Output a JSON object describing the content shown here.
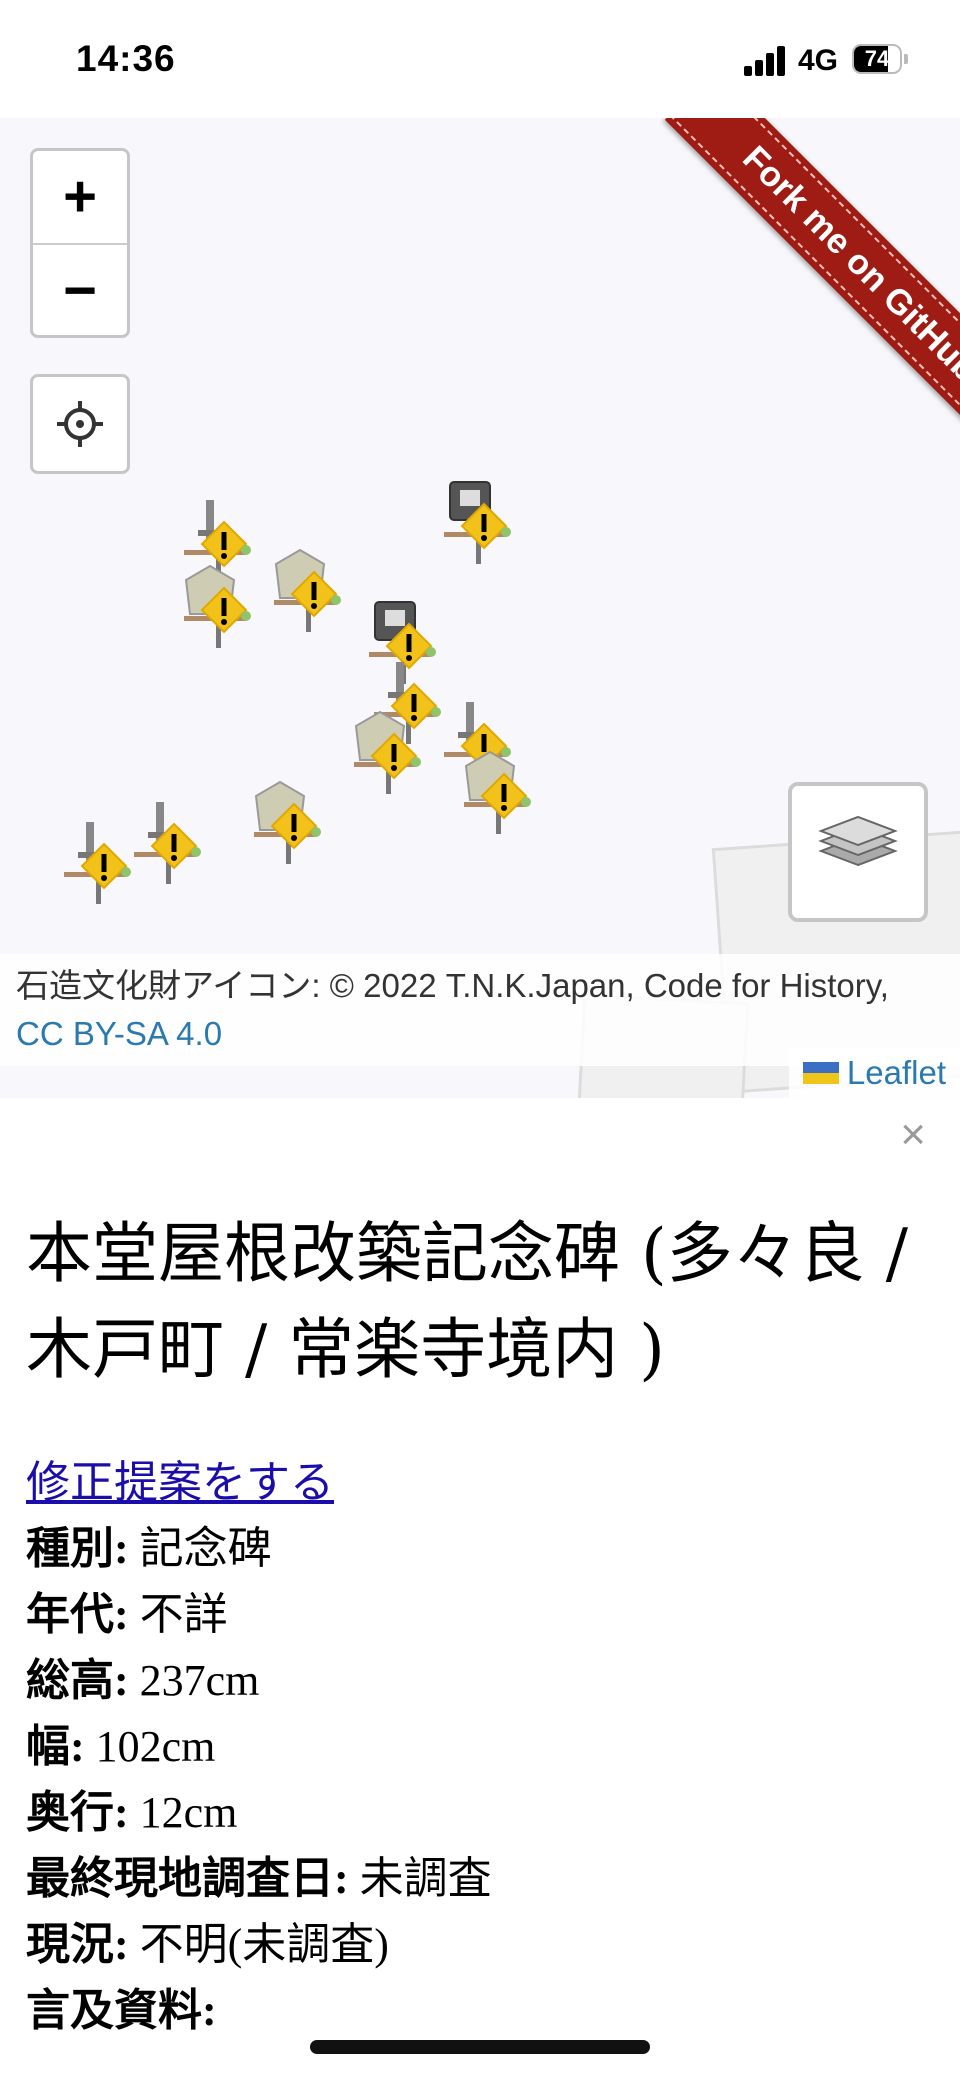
{
  "status": {
    "time": "14:36",
    "network": "4G",
    "battery": "74",
    "battery_level": 0.74
  },
  "map": {
    "zoom_in": "+",
    "zoom_out": "−",
    "ribbon": "Fork me on GitHub",
    "attribution_text": "石造文化財アイコン: © 2022 T.N.K.Japan, Code for History, ",
    "attribution_link": "CC BY-SA 4.0",
    "leaflet": "Leaflet"
  },
  "panel": {
    "close": "×",
    "title": "本堂屋根改築記念碑 (多々良 / 木戸町 / 常楽寺境内 )",
    "edit_link": "修正提案をする",
    "fields": [
      {
        "label": "種別:",
        "value": " 記念碑"
      },
      {
        "label": "年代:",
        "value": " 不詳"
      },
      {
        "label": "総高:",
        "value": " 237cm"
      },
      {
        "label": "幅:",
        "value": " 102cm"
      },
      {
        "label": "奥行:",
        "value": " 12cm"
      },
      {
        "label": "最終現地調査日:",
        "value": " 未調査"
      },
      {
        "label": "現況:",
        "value": " 不明(未調査)"
      },
      {
        "label": "言及資料:",
        "value": ""
      }
    ]
  }
}
